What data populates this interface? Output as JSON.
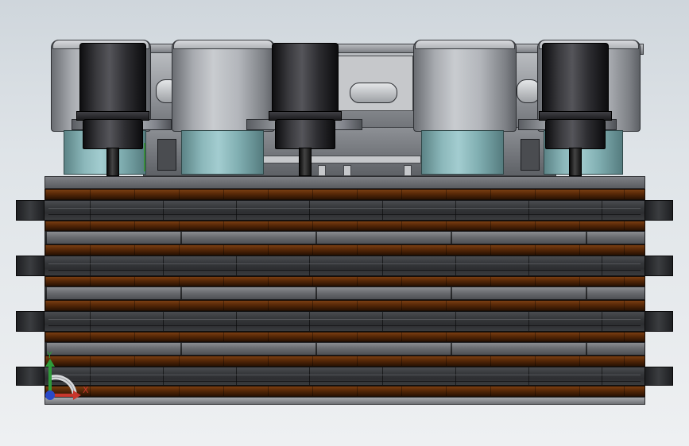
{
  "viewport": {
    "background_top": "#cfd6dc",
    "background_bottom": "#eef0f2"
  },
  "triad": {
    "x_label": "X",
    "y_label": "Y",
    "colors": {
      "x_axis": "#c8372d",
      "y_axis": "#2f9b3a",
      "z_axis": "#2a49c8"
    },
    "icons": [
      "x-axis-arrow-icon",
      "y-axis-arrow-icon",
      "z-axis-dot-icon",
      "view-rotation-arc-icon"
    ]
  },
  "model": {
    "palette": {
      "steel": "#8b8d91",
      "wood": "#5a2a08",
      "teal": "#8cb8bb",
      "black_cap": "#2e2e32",
      "dark_plate": "#36383b"
    }
  }
}
